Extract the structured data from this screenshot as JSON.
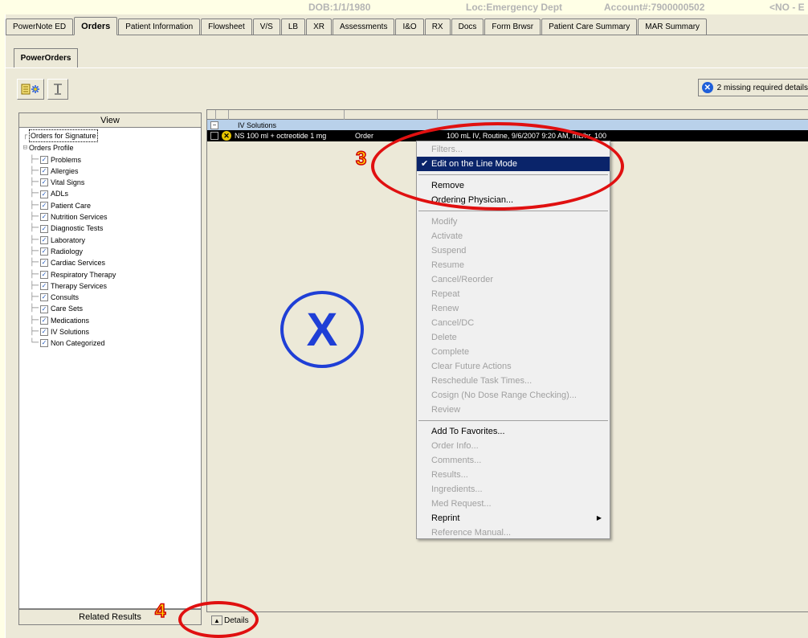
{
  "banner": {
    "dob": "DOB:1/1/1980",
    "loc": "Loc:Emergency Dept",
    "account": "Account#:7900000502",
    "extra": "<NO - E"
  },
  "tabs": [
    {
      "label": "PowerNote ED"
    },
    {
      "label": "Orders",
      "active": true
    },
    {
      "label": "Patient Information"
    },
    {
      "label": "Flowsheet"
    },
    {
      "label": "V/S"
    },
    {
      "label": "LB"
    },
    {
      "label": "XR"
    },
    {
      "label": "Assessments"
    },
    {
      "label": "I&O"
    },
    {
      "label": "RX"
    },
    {
      "label": "Docs"
    },
    {
      "label": "Form Brwsr"
    },
    {
      "label": "Patient Care Summary"
    },
    {
      "label": "MAR Summary"
    }
  ],
  "subtab": {
    "label": "PowerOrders"
  },
  "toolbar": {
    "add_icon": "add-order-icon",
    "sort_icon": "sort-icon",
    "missing_text": "2 missing required details"
  },
  "view_panel": {
    "header": "View",
    "root_item": "Orders for Signature",
    "profile_item": "Orders Profile",
    "categories": [
      "Problems",
      "Allergies",
      "Vital Signs",
      "ADLs",
      "Patient Care",
      "Nutrition Services",
      "Diagnostic Tests",
      "Laboratory",
      "Radiology",
      "Cardiac Services",
      "Respiratory Therapy",
      "Therapy Services",
      "Consults",
      "Care Sets",
      "Medications",
      "IV Solutions",
      "Non Categorized"
    ],
    "related_results": "Related Results"
  },
  "orders": {
    "category": "IV Solutions",
    "row": {
      "name": "NS 100 ml + octreotide 1 mg",
      "type": "Order",
      "details": "100 mL IV, Routine, 9/6/2007 9:20 AM, mL/hr, 100"
    }
  },
  "context_menu": {
    "groups": [
      [
        {
          "label": "Filters...",
          "disabled": true
        },
        {
          "label": "Edit on the Line Mode",
          "checked": true,
          "selected": true
        }
      ],
      [
        {
          "label": "Remove"
        },
        {
          "label": "Ordering Physician..."
        }
      ],
      [
        {
          "label": "Modify",
          "disabled": true
        },
        {
          "label": "Activate",
          "disabled": true
        },
        {
          "label": "Suspend",
          "disabled": true
        },
        {
          "label": "Resume",
          "disabled": true
        },
        {
          "label": "Cancel/Reorder",
          "disabled": true
        },
        {
          "label": "Repeat",
          "disabled": true
        },
        {
          "label": "Renew",
          "disabled": true
        },
        {
          "label": "Cancel/DC",
          "disabled": true
        },
        {
          "label": "Delete",
          "disabled": true
        },
        {
          "label": "Complete",
          "disabled": true
        },
        {
          "label": "Clear Future Actions",
          "disabled": true
        },
        {
          "label": "Reschedule Task Times...",
          "disabled": true
        },
        {
          "label": "Cosign (No Dose Range Checking)...",
          "disabled": true
        },
        {
          "label": "Review",
          "disabled": true
        }
      ],
      [
        {
          "label": "Add To Favorites..."
        },
        {
          "label": "Order Info...",
          "disabled": true
        },
        {
          "label": "Comments...",
          "disabled": true
        },
        {
          "label": "Results...",
          "disabled": true
        },
        {
          "label": "Ingredients...",
          "disabled": true
        },
        {
          "label": "Med Request...",
          "disabled": true
        },
        {
          "label": "Reprint",
          "submenu": true
        },
        {
          "label": "Reference Manual...",
          "disabled": true
        }
      ]
    ]
  },
  "details_bar": {
    "label": "Details"
  },
  "annotations": {
    "step3": "3",
    "step4": "4",
    "x_mark": "X",
    "ring_color": "#e01010",
    "x_color": "#1f3fd6",
    "number_color": "#ffd800"
  }
}
